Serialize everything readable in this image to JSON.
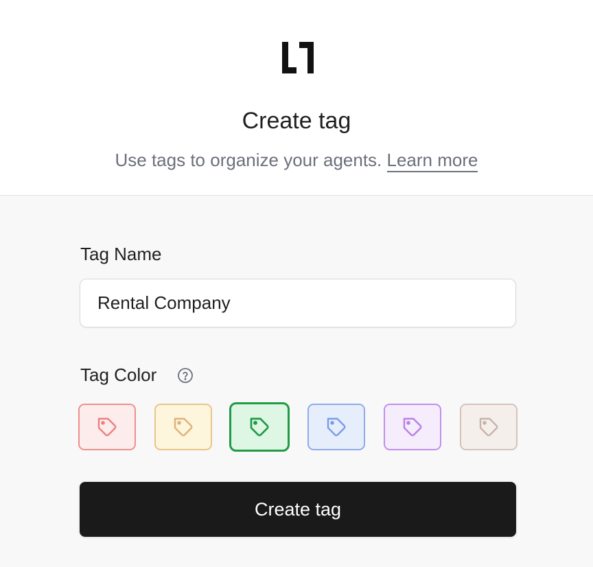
{
  "header": {
    "logo_icon": "letter-l-bracket-logo-icon",
    "title": "Create tag",
    "subtitle": "Use tags to organize your agents.",
    "learn_more": "Learn more"
  },
  "form": {
    "name_label": "Tag Name",
    "name_value": "Rental Company",
    "color_label": "Tag Color",
    "help_icon": "question-circle-icon",
    "colors": [
      {
        "name": "red",
        "bg": "#fdecec",
        "border": "#ee8f8f",
        "icon": "#ec8080",
        "selected": false
      },
      {
        "name": "yellow",
        "bg": "#fdf5dc",
        "border": "#e8c489",
        "icon": "#dfb27a",
        "selected": false
      },
      {
        "name": "green",
        "bg": "#def6e4",
        "border": "#1f9a45",
        "icon": "#1f9a45",
        "selected": true
      },
      {
        "name": "blue",
        "bg": "#e6eefc",
        "border": "#8fa9ec",
        "icon": "#7b9be8",
        "selected": false
      },
      {
        "name": "purple",
        "bg": "#f5ecfc",
        "border": "#c08fec",
        "icon": "#b97fe8",
        "selected": false
      },
      {
        "name": "brown",
        "bg": "#f5efeb",
        "border": "#d4c2bb",
        "icon": "#c8b3aa",
        "selected": false
      }
    ],
    "submit_label": "Create tag"
  }
}
